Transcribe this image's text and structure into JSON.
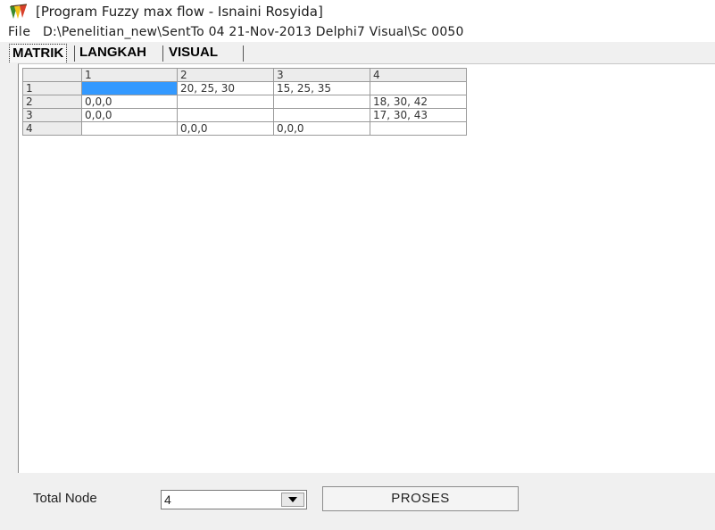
{
  "window": {
    "title": "[Program Fuzzy max flow - Isnaini Rosyida]"
  },
  "menubar": {
    "file_label": "File",
    "path_text": "D:\\Penelitian_new\\SentTo 04 21-Nov-2013 Delphi7 Visual\\Sc 0050"
  },
  "tabs": [
    {
      "label": "MATRIK",
      "active": true
    },
    {
      "label": "LANGKAH",
      "active": false
    },
    {
      "label": "VISUAL",
      "active": false
    }
  ],
  "grid": {
    "column_headers": [
      "",
      "1",
      "2",
      "3",
      "4"
    ],
    "rows": [
      {
        "header": "1",
        "cells": [
          "",
          "20, 25, 30",
          "15, 25, 35",
          ""
        ]
      },
      {
        "header": "2",
        "cells": [
          "0,0,0",
          "",
          "",
          "18, 30, 42"
        ]
      },
      {
        "header": "3",
        "cells": [
          "0,0,0",
          "",
          "",
          "17, 30, 43"
        ]
      },
      {
        "header": "4",
        "cells": [
          "",
          "0,0,0",
          "0,0,0",
          ""
        ]
      }
    ]
  },
  "bottom": {
    "total_node_label": "Total Node",
    "total_node_value": "4",
    "proses_label": "PROSES"
  },
  "colors": {
    "selection": "#3399ff",
    "header_bg": "#ececec"
  }
}
